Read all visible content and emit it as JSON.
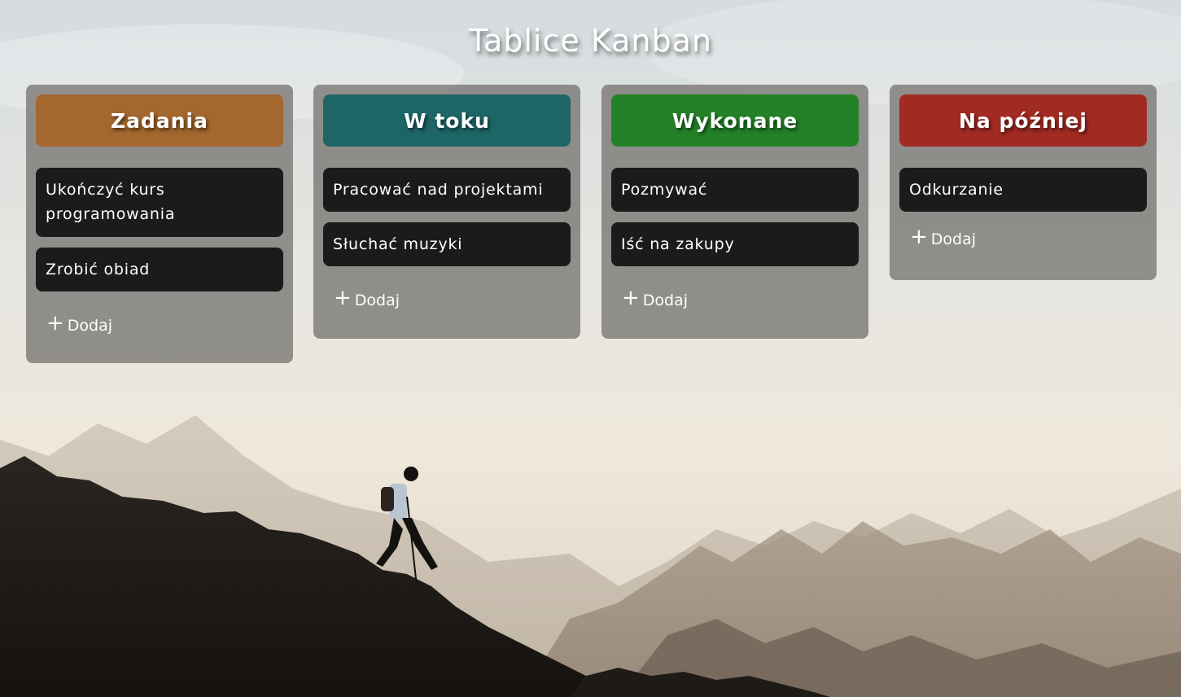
{
  "page": {
    "title": "Tablice Kanban"
  },
  "colors": {
    "zadania": "#a4672d",
    "w_toku": "#1d6566",
    "wykonane": "#238227",
    "na_pozniej": "#a12b23",
    "card_bg": "#1b1b1b"
  },
  "boards": [
    {
      "title": "Zadania",
      "cards": [
        "Ukończyć kurs programowania",
        "Zrobić obiad"
      ],
      "add_label": "Dodaj",
      "add_icon": "plus-icon"
    },
    {
      "title": "W toku",
      "cards": [
        "Pracować nad projektami",
        "Słuchać muzyki"
      ],
      "add_label": "Dodaj",
      "add_icon": "plus-icon"
    },
    {
      "title": "Wykonane",
      "cards": [
        "Pozmywać",
        "Iść na zakupy"
      ],
      "add_label": "Dodaj",
      "add_icon": "plus-icon"
    },
    {
      "title": "Na później",
      "cards": [
        "Odkurzanie"
      ],
      "add_label": "Dodaj",
      "add_icon": "plus-icon"
    }
  ]
}
